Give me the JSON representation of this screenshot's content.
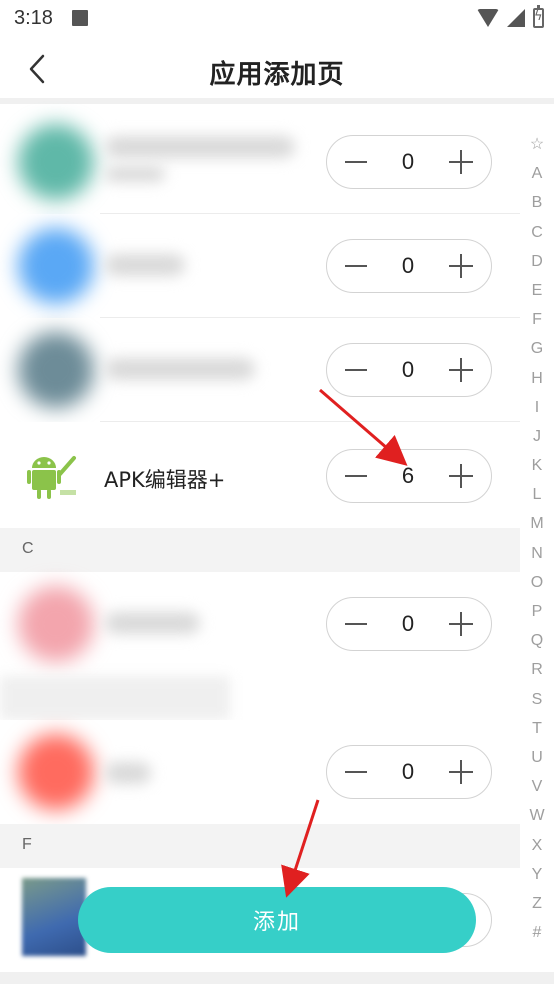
{
  "status_bar": {
    "time": "3:18"
  },
  "header": {
    "title": "应用添加页"
  },
  "rows": [
    {
      "count": "0",
      "icon_color": "#5fb8a8"
    },
    {
      "count": "0",
      "icon_color": "#5aa8f5"
    },
    {
      "count": "0",
      "icon_color": "#6d8c98"
    },
    {
      "name": "APK编辑器+",
      "count": "6"
    },
    {
      "count": "0",
      "icon_color": "#f3a5ad"
    },
    {
      "count": "0",
      "icon_color": "#ff6b5f"
    }
  ],
  "sections": {
    "c": "C",
    "f": "F"
  },
  "index": [
    "☆",
    "A",
    "B",
    "C",
    "D",
    "E",
    "F",
    "G",
    "H",
    "I",
    "J",
    "K",
    "L",
    "M",
    "N",
    "O",
    "P",
    "Q",
    "R",
    "S",
    "T",
    "U",
    "V",
    "W",
    "X",
    "Y",
    "Z",
    "#"
  ],
  "add_button": {
    "label": "添加"
  },
  "colors": {
    "accent": "#36cfc8",
    "arrow": "#e02020"
  }
}
